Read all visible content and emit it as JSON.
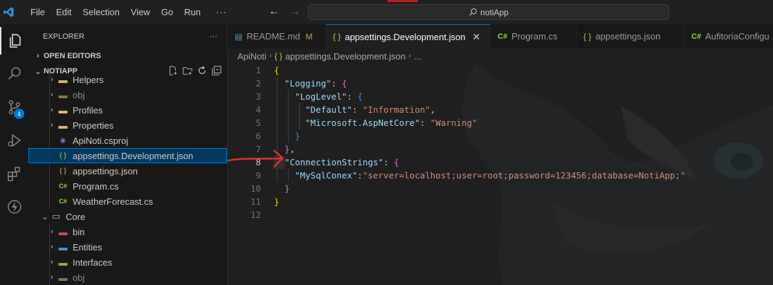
{
  "titlebar": {
    "menu": [
      "File",
      "Edit",
      "Selection",
      "View",
      "Go",
      "Run"
    ],
    "more": "···",
    "search_text": "notiApp",
    "back_icon": "arrow-left-icon",
    "forward_icon": "arrow-right-icon"
  },
  "activity_bar": {
    "items": [
      "explorer-icon",
      "search-icon",
      "source-control-icon",
      "run-debug-icon",
      "extensions-icon",
      "lightning-icon"
    ],
    "source_control_badge": "4"
  },
  "explorer": {
    "title": "EXPLORER",
    "title_more": "···",
    "open_editors": "OPEN EDITORS",
    "project": "NOTIAPP",
    "tree": [
      {
        "label": "Helpers",
        "type": "folder",
        "level": 1,
        "expandable": true
      },
      {
        "label": "obj",
        "type": "folder-muted",
        "level": 1,
        "expandable": true
      },
      {
        "label": "Profiles",
        "type": "folder",
        "level": 1,
        "expandable": true
      },
      {
        "label": "Properties",
        "type": "folder",
        "level": 1,
        "expandable": true
      },
      {
        "label": "ApiNoti.csproj",
        "type": "csproj",
        "level": 1,
        "expandable": false
      },
      {
        "label": "appsettings.Development.json",
        "type": "json",
        "level": 1,
        "expandable": false,
        "selected": true
      },
      {
        "label": "appsettings.json",
        "type": "json",
        "level": 1,
        "expandable": false
      },
      {
        "label": "Program.cs",
        "type": "cs",
        "level": 1,
        "expandable": false
      },
      {
        "label": "WeatherForecast.cs",
        "type": "cs",
        "level": 1,
        "expandable": false
      },
      {
        "label": "Core",
        "type": "folder-open",
        "level": 0,
        "expandable": true,
        "expanded": true
      },
      {
        "label": "bin",
        "type": "folder-bin",
        "level": 1,
        "expandable": true
      },
      {
        "label": "Entities",
        "type": "folder-entities",
        "level": 1,
        "expandable": true
      },
      {
        "label": "Interfaces",
        "type": "folder-interfaces",
        "level": 1,
        "expandable": true
      },
      {
        "label": "obj",
        "type": "folder-muted",
        "level": 1,
        "expandable": true
      }
    ]
  },
  "tabs": [
    {
      "label": "README.md",
      "icon": "M",
      "suffix": "M",
      "active": false
    },
    {
      "label": "appsettings.Development.json",
      "icon": "{ }",
      "close": "✕",
      "active": true
    },
    {
      "label": "Program.cs",
      "icon": "C#",
      "active": false
    },
    {
      "label": "appsettings.json",
      "icon": "{ }",
      "active": false
    },
    {
      "label": "AufitoriaConfigu",
      "icon": "C#",
      "active": false
    }
  ],
  "breadcrumbs": {
    "root": "ApiNoti",
    "file": "appsettings.Development.json",
    "tail": "..."
  },
  "code": {
    "line_numbers": [
      "1",
      "2",
      "3",
      "4",
      "5",
      "6",
      "7",
      "8",
      "9",
      "10",
      "11",
      "12"
    ],
    "l2_key": "\"Logging\"",
    "l3_key": "\"LogLevel\"",
    "l4_key": "\"Default\"",
    "l4_val": "\"Information\"",
    "l5_key": "\"Microsoft.AspNetCore\"",
    "l5_val": "\"Warning\"",
    "l8_key": "\"ConnectionStrings\"",
    "l9_key": "\"MySqlConex\"",
    "l9_val": "\"server=localhost;user=root;password=123456;database=NotiApp;\""
  },
  "annotation_color": "#e03030"
}
